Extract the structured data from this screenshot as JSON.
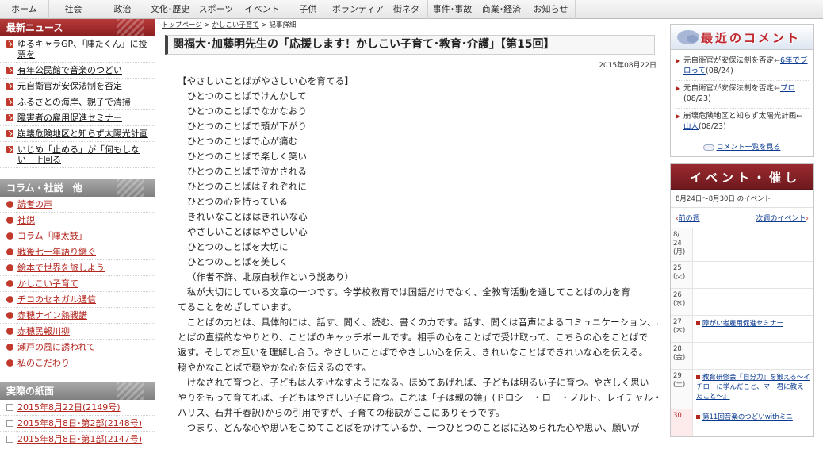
{
  "topnav": [
    "ホーム",
    "社会",
    "政治",
    "文化･歴史",
    "スポーツ",
    "イベント",
    "子供",
    "ボランティア",
    "街ネタ",
    "事件･事故",
    "商業･経済",
    "お知らせ"
  ],
  "sidebar": {
    "news_header": "最新ニュース",
    "news": [
      "ゆるキャラGP、「陣たくん」に投票を",
      "有年公民館で音楽のつどい",
      "元自衛官が安保法制を否定",
      "ふるさとの海岸、親子で清掃",
      "障害者の雇用促進セミナー",
      "崩壊危険地区と知らず太陽光計画",
      "いじめ「止める」が「何もしない」上回る"
    ],
    "column_header": "コラム・社説　他",
    "columns": [
      "読者の声",
      "社説",
      "コラム「陣太鼓」",
      "戦後七十年語り継ぐ",
      "絵本で世界を旅しよう",
      "かしこい子育て",
      "チコのセネガル通信",
      "赤穂ナイン熱戦譜",
      "赤穂民報川柳",
      "瀬戸の風に誘われて",
      "私のこだわり"
    ],
    "paper_header": "実際の紙面",
    "papers": [
      "2015年8月22日(2149号)",
      "2015年8月8日･第2部(2148号)",
      "2015年8月8日･第1部(2147号)"
    ]
  },
  "main": {
    "breadcrumb": {
      "top": "トップページ",
      "sep": ">",
      "section": "かしこい子育て",
      "current": "記事詳細"
    },
    "title": "関福大･加藤明先生の「応援します！かしこい子育て･教育･介護」【第15回】",
    "date": "2015年08月22日",
    "poem_heading": "【やさしいことばがやさしい心を育てる】",
    "poem": [
      "ひとつのことばでけんかして",
      "ひとつのことばでなかなおり",
      "ひとつのことばで頭が下がり",
      "ひとつのことばで心が痛む",
      "ひとつのことばで楽しく笑い",
      "ひとつのことばで泣かされる",
      "ひとつのことばはそれぞれに",
      "ひとつの心を持っている",
      "きれいなことばはきれいな心",
      "やさしいことばはやさしい心",
      "ひとつのことばを大切に",
      "ひとつのことばを美しく",
      "（作者不詳、北原白秋作という説あり）"
    ],
    "paragraphs": [
      "　私が大切にしている文章の一つです。今学校教育では国語だけでなく、全教育活動を通してことばの力を育",
      "てることをめざしています。",
      "　ことばの力とは、具体的には、話す、聞く、読む、書くの力です。話す、聞くは音声によるコミュニケーション、こ",
      "とばの直接的なやりとり、ことばのキャッチボールです。相手の心をことばで受け取って、こちらの心をことばで",
      "返す。そしてお互いを理解し合う。やさしいことばでやさしい心を伝え、きれいなことばできれいな心を伝える。",
      "穏やかなことばで穏やかな心を伝えるのです。",
      "　けなされて育つと、子どもは人をけなすようになる。ほめてあげれば、子どもは明るい子に育つ。やさしく思い",
      "やりをもって育てれば、子どもはやさしい子に育つ。これは「子は親の鏡」(ドロシー・ロー・ノルト、レイチャル・",
      "ハリス、石井千春訳)からの引用ですが、子育ての秘訣がここにありそうです。",
      "　つまり、どんな心や思いをこめてことばをかけているか、一つひとつのことばに込められた心や思い、願いが"
    ]
  },
  "comments": {
    "header": "最近のコメント",
    "items": [
      {
        "text": "元自衛官が安保法制を否定←",
        "link": "6年でブロって",
        "date": "(08/24)"
      },
      {
        "text": "元自衛官が安保法制を否定←",
        "link": "ブロ",
        "date": "(08/23)"
      },
      {
        "text": "崩壊危険地区と知らず太陽光計画←",
        "link": "山人",
        "date": "(08/23)"
      }
    ],
    "all_link": "コメント一覧を見る"
  },
  "events": {
    "header": "イベント・催し",
    "range": "8月24日～8月30日 のイベント",
    "prev": "前の週",
    "next": "次週のイベント",
    "days": [
      {
        "day": "8/\n24\n(月)",
        "events": []
      },
      {
        "day": "25\n(火)",
        "events": []
      },
      {
        "day": "26\n(水)",
        "events": []
      },
      {
        "day": "27\n(木)",
        "events": [
          "障がい者雇用促進セミナー"
        ]
      },
      {
        "day": "28\n(金)",
        "events": []
      },
      {
        "day": "29\n(土)",
        "events": [
          "教育研修会『自分力』を鍛える～イチローに学んだこと、マー君に教えたこと～』"
        ]
      },
      {
        "day": "30",
        "events": [
          "第11回音楽のつどいwithミニ"
        ]
      }
    ]
  },
  "colors": {
    "accent_red": "#c0262d",
    "link_blue": "#0b3b91"
  }
}
